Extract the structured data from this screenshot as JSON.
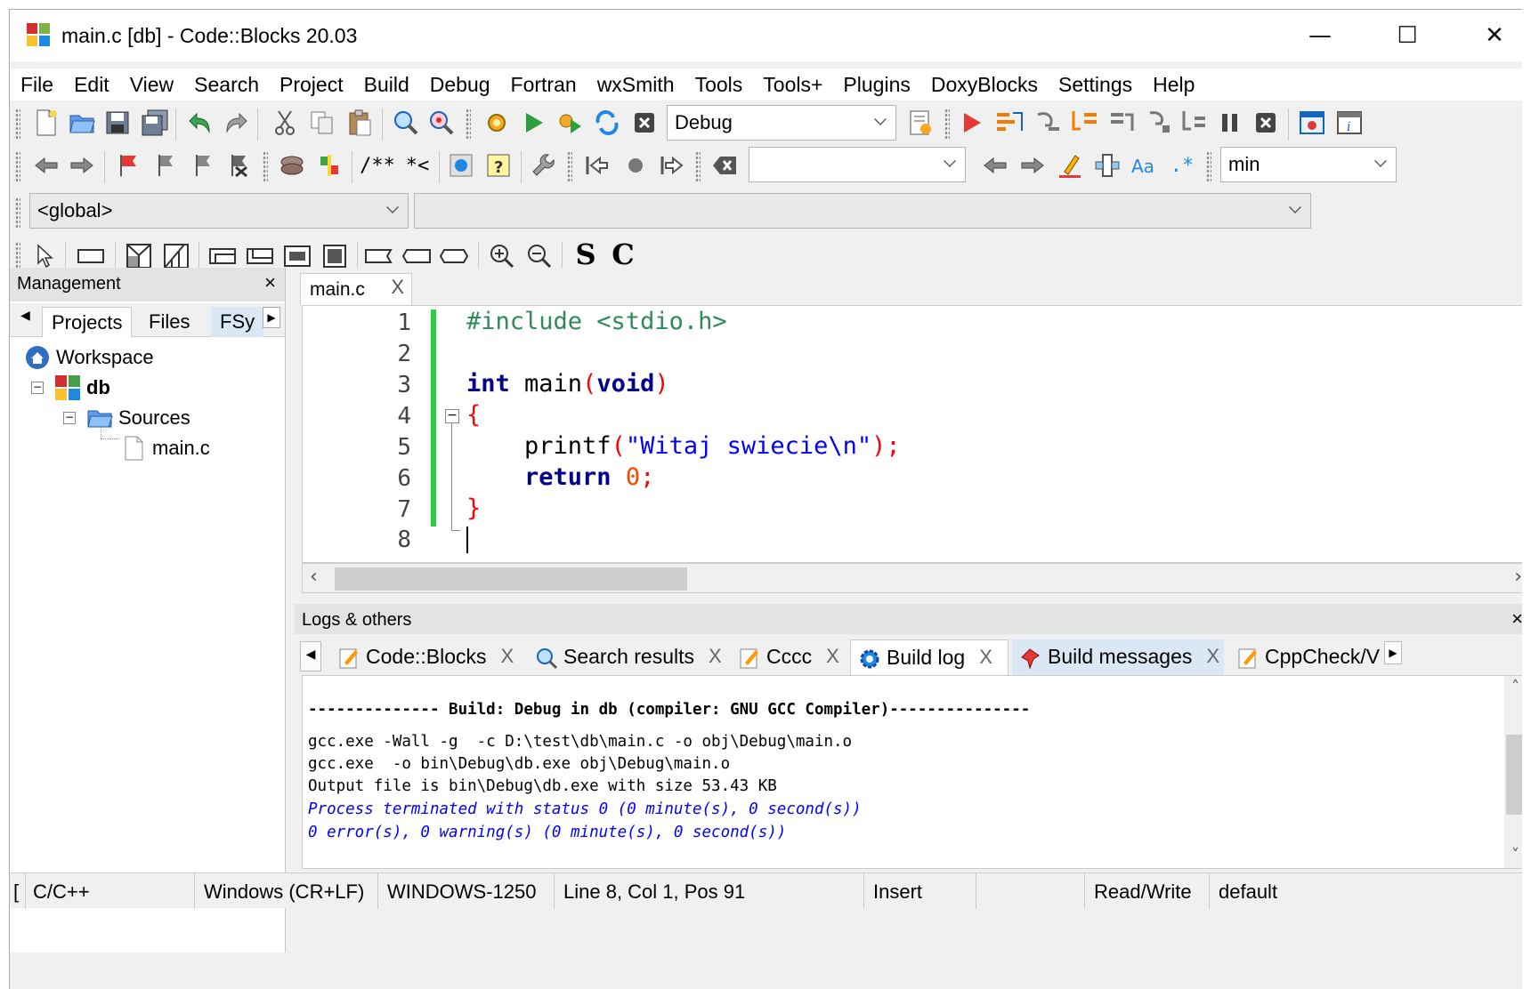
{
  "window": {
    "title": "main.c [db] - Code::Blocks 20.03",
    "min_glyph": "—",
    "max_glyph": "☐",
    "close_glyph": "✕"
  },
  "menu": [
    "File",
    "Edit",
    "View",
    "Search",
    "Project",
    "Build",
    "Debug",
    "Fortran",
    "wxSmith",
    "Tools",
    "Tools+",
    "Plugins",
    "DoxyBlocks",
    "Settings",
    "Help"
  ],
  "toolbar": {
    "build_target": "Debug",
    "search_combo": "",
    "min_combo": "min",
    "scope_combo": "<global>",
    "function_combo": "",
    "comment_glyph": "/**",
    "stream_glyph": "*<",
    "regex_glyph": ".*",
    "font_s": "S",
    "font_c": "C"
  },
  "management": {
    "title": "Management",
    "close": "×",
    "tabs": [
      "Projects",
      "Files",
      "FSy"
    ],
    "tree": {
      "workspace": "Workspace",
      "project": "db",
      "folder": "Sources",
      "file": "main.c"
    }
  },
  "editor": {
    "tab_label": "main.c",
    "tab_close": "X",
    "line_numbers": [
      "1",
      "2",
      "3",
      "4",
      "5",
      "6",
      "7",
      "8"
    ],
    "code": {
      "l1": "#include <stdio.h>",
      "l3_kw1": "int",
      "l3_fn": " main",
      "l3_p1": "(",
      "l3_kw2": "void",
      "l3_p2": ")",
      "l4": "{",
      "l5_fn": "    printf",
      "l5_p1": "(",
      "l5_str": "\"Witaj swiecie\\n\"",
      "l5_p2": ");",
      "l6_kw": "    return",
      "l6_num": " 0",
      "l6_semi": ";",
      "l7": "}"
    }
  },
  "logs": {
    "title": "Logs & others",
    "close": "×",
    "tabs": [
      {
        "label": "Code::Blocks",
        "close": "X"
      },
      {
        "label": "Search results",
        "close": "X"
      },
      {
        "label": "Cccc",
        "close": "X"
      },
      {
        "label": "Build log",
        "close": "X"
      },
      {
        "label": "Build messages",
        "close": "X"
      },
      {
        "label": "CppCheck/V"
      }
    ],
    "lines": [
      "-------------- Build: Debug in db (compiler: GNU GCC Compiler)---------------",
      "gcc.exe -Wall -g  -c D:\\test\\db\\main.c -o obj\\Debug\\main.o",
      "gcc.exe  -o bin\\Debug\\db.exe obj\\Debug\\main.o",
      "Output file is bin\\Debug\\db.exe with size 53.43 KB",
      "Process terminated with status 0 (0 minute(s), 0 second(s))",
      "0 error(s), 0 warning(s) (0 minute(s), 0 second(s))"
    ]
  },
  "status": {
    "lang": "C/C++",
    "lang_prefix": "[",
    "eol": "Windows (CR+LF)",
    "encoding": "WINDOWS-1250",
    "position": "Line 8, Col 1, Pos 91",
    "mode": "Insert",
    "access": "Read/Write",
    "profile": "default"
  },
  "colors": {
    "keyword": "#00008b",
    "preprocessor": "#2e8b57",
    "string": "#0000ff",
    "number": "#ff4500",
    "change_bar": "#2ecc40",
    "log_info": "#0000ff"
  }
}
